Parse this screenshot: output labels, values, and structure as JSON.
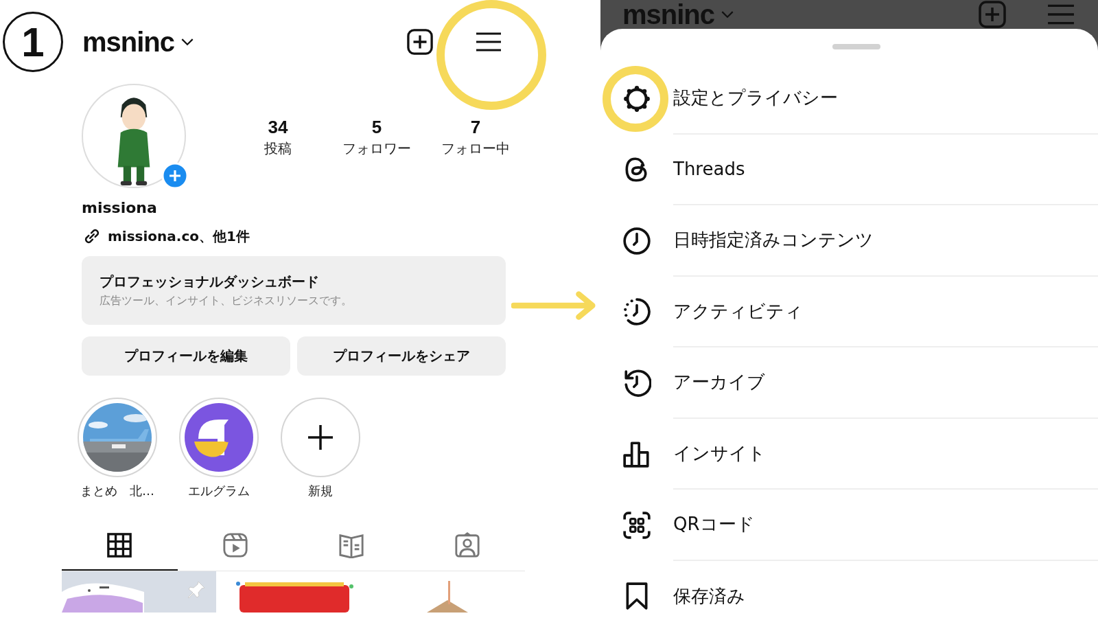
{
  "step_number": "1",
  "profile": {
    "username": "msninc",
    "stats": [
      {
        "value": "34",
        "label": "投稿"
      },
      {
        "value": "5",
        "label": "フォロワー"
      },
      {
        "value": "7",
        "label": "フォロー中"
      }
    ],
    "name": "missiona",
    "link": "missiona.co、他1件",
    "dashboard": {
      "title": "プロフェッショナルダッシュボード",
      "subtitle": "広告ツール、インサイト、ビジネスリソースです。"
    },
    "buttons": [
      "プロフィールを編集",
      "プロフィールをシェア"
    ],
    "highlights": [
      {
        "label": "まとめ　北…",
        "kind": "picture"
      },
      {
        "label": "エルグラム",
        "kind": "logo"
      },
      {
        "label": "新規",
        "kind": "new"
      }
    ],
    "tabs": [
      {
        "selected": true
      },
      {
        "selected": false
      },
      {
        "selected": false
      },
      {
        "selected": false
      }
    ],
    "posts": [
      {
        "kind": "picture"
      },
      {
        "kind": "picture"
      },
      {
        "kind": "picture"
      }
    ]
  },
  "menu": {
    "username": "msninc",
    "items": [
      {
        "label": "設定とプライバシー",
        "highlighted": true
      },
      {
        "label": "Threads",
        "highlighted": false
      },
      {
        "label": "日時指定済みコンテンツ",
        "highlighted": false
      },
      {
        "label": "アクティビティ",
        "highlighted": false
      },
      {
        "label": "アーカイブ",
        "highlighted": false
      },
      {
        "label": "インサイト",
        "highlighted": false
      },
      {
        "label": "QRコード",
        "highlighted": false
      },
      {
        "label": "保存済み",
        "highlighted": false
      }
    ]
  }
}
